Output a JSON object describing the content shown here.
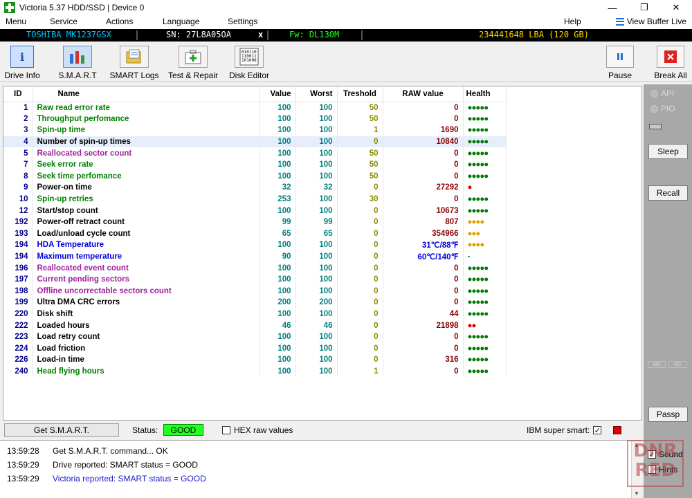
{
  "window": {
    "title": "Victoria 5.37 HDD/SSD | Device 0"
  },
  "menu": {
    "items": [
      "Menu",
      "Service",
      "Actions",
      "Language",
      "Settings",
      "Help"
    ],
    "view_buffer_live": "View Buffer Live"
  },
  "device": {
    "model": "TOSHIBA MK1237GSX",
    "serial": "SN: 27L8A05OA",
    "close": "x",
    "firmware": "Fw: DL130M",
    "capacity": "234441648 LBA (120 GB)"
  },
  "toolbar": {
    "drive_info": "Drive Info",
    "smart": "S.M.A.R.T",
    "smart_logs": "SMART Logs",
    "test_repair": "Test & Repair",
    "disk_editor": "Disk Editor",
    "pause": "Pause",
    "break_all": "Break All"
  },
  "table": {
    "headers": [
      "ID",
      "Name",
      "Value",
      "Worst",
      "Treshold",
      "RAW value",
      "Health"
    ],
    "rows": [
      {
        "id": "1",
        "name": "Raw read error rate",
        "value": "100",
        "worst": "100",
        "thresh": "50",
        "raw": "0",
        "health": "●●●●●",
        "color": "green",
        "hcolor": "green"
      },
      {
        "id": "2",
        "name": "Throughput perfomance",
        "value": "100",
        "worst": "100",
        "thresh": "50",
        "raw": "0",
        "health": "●●●●●",
        "color": "green",
        "hcolor": "green"
      },
      {
        "id": "3",
        "name": "Spin-up time",
        "value": "100",
        "worst": "100",
        "thresh": "1",
        "raw": "1690",
        "health": "●●●●●",
        "color": "green",
        "hcolor": "green"
      },
      {
        "id": "4",
        "name": "Number of spin-up times",
        "value": "100",
        "worst": "100",
        "thresh": "0",
        "raw": "10840",
        "health": "●●●●●",
        "color": "black",
        "hcolor": "green"
      },
      {
        "id": "5",
        "name": "Reallocated sector count",
        "value": "100",
        "worst": "100",
        "thresh": "50",
        "raw": "0",
        "health": "●●●●●",
        "color": "purple",
        "hcolor": "green"
      },
      {
        "id": "7",
        "name": "Seek error rate",
        "value": "100",
        "worst": "100",
        "thresh": "50",
        "raw": "0",
        "health": "●●●●●",
        "color": "green",
        "hcolor": "green"
      },
      {
        "id": "8",
        "name": "Seek time perfomance",
        "value": "100",
        "worst": "100",
        "thresh": "50",
        "raw": "0",
        "health": "●●●●●",
        "color": "green",
        "hcolor": "green"
      },
      {
        "id": "9",
        "name": "Power-on time",
        "value": "32",
        "worst": "32",
        "thresh": "0",
        "raw": "27292",
        "health": "●",
        "color": "black",
        "hcolor": "red"
      },
      {
        "id": "10",
        "name": "Spin-up retries",
        "value": "253",
        "worst": "100",
        "thresh": "30",
        "raw": "0",
        "health": "●●●●●",
        "color": "green",
        "hcolor": "green"
      },
      {
        "id": "12",
        "name": "Start/stop count",
        "value": "100",
        "worst": "100",
        "thresh": "0",
        "raw": "10673",
        "health": "●●●●●",
        "color": "black",
        "hcolor": "green"
      },
      {
        "id": "192",
        "name": "Power-off retract count",
        "value": "99",
        "worst": "99",
        "thresh": "0",
        "raw": "807",
        "health": "●●●●",
        "color": "black",
        "hcolor": "yellow"
      },
      {
        "id": "193",
        "name": "Load/unload cycle count",
        "value": "65",
        "worst": "65",
        "thresh": "0",
        "raw": "354966",
        "health": "●●●",
        "color": "black",
        "hcolor": "yellow"
      },
      {
        "id": "194",
        "name": "HDA Temperature",
        "value": "100",
        "worst": "100",
        "thresh": "0",
        "raw": "31℃/88℉",
        "health": "●●●●",
        "color": "blue",
        "hcolor": "yellow"
      },
      {
        "id": "194",
        "name": "Maximum temperature",
        "value": "90",
        "worst": "100",
        "thresh": "0",
        "raw": "60℃/140℉",
        "health": "-",
        "color": "blue",
        "hcolor": "green"
      },
      {
        "id": "196",
        "name": "Reallocated event count",
        "value": "100",
        "worst": "100",
        "thresh": "0",
        "raw": "0",
        "health": "●●●●●",
        "color": "purple",
        "hcolor": "green"
      },
      {
        "id": "197",
        "name": "Current pending sectors",
        "value": "100",
        "worst": "100",
        "thresh": "0",
        "raw": "0",
        "health": "●●●●●",
        "color": "purple",
        "hcolor": "green"
      },
      {
        "id": "198",
        "name": "Offline uncorrectable sectors count",
        "value": "100",
        "worst": "100",
        "thresh": "0",
        "raw": "0",
        "health": "●●●●●",
        "color": "purple",
        "hcolor": "green"
      },
      {
        "id": "199",
        "name": "Ultra DMA CRC errors",
        "value": "200",
        "worst": "200",
        "thresh": "0",
        "raw": "0",
        "health": "●●●●●",
        "color": "black",
        "hcolor": "green"
      },
      {
        "id": "220",
        "name": "Disk shift",
        "value": "100",
        "worst": "100",
        "thresh": "0",
        "raw": "44",
        "health": "●●●●●",
        "color": "black",
        "hcolor": "green"
      },
      {
        "id": "222",
        "name": "Loaded hours",
        "value": "46",
        "worst": "46",
        "thresh": "0",
        "raw": "21898",
        "health": "●●",
        "color": "black",
        "hcolor": "red"
      },
      {
        "id": "223",
        "name": "Load retry count",
        "value": "100",
        "worst": "100",
        "thresh": "0",
        "raw": "0",
        "health": "●●●●●",
        "color": "black",
        "hcolor": "green"
      },
      {
        "id": "224",
        "name": "Load friction",
        "value": "100",
        "worst": "100",
        "thresh": "0",
        "raw": "0",
        "health": "●●●●●",
        "color": "black",
        "hcolor": "green"
      },
      {
        "id": "226",
        "name": "Load-in time",
        "value": "100",
        "worst": "100",
        "thresh": "0",
        "raw": "316",
        "health": "●●●●●",
        "color": "black",
        "hcolor": "green"
      },
      {
        "id": "240",
        "name": "Head flying hours",
        "value": "100",
        "worst": "100",
        "thresh": "1",
        "raw": "0",
        "health": "●●●●●",
        "color": "green",
        "hcolor": "green"
      }
    ]
  },
  "right_panel": {
    "api": "API",
    "pio": "PIO",
    "sleep": "Sleep",
    "recall": "Recall",
    "wr": "WR",
    "rd": "RD",
    "passp": "Passp"
  },
  "statusbar": {
    "get_smart": "Get S.M.A.R.T.",
    "status_label": "Status:",
    "status_value": "GOOD",
    "hex_raw": "HEX raw values",
    "ibm_super_smart": "IBM super smart:",
    "ibm_checked": "✓"
  },
  "log": [
    {
      "time": "13:59:28",
      "text": "Get S.M.A.R.T. command... OK",
      "color": "#000000"
    },
    {
      "time": "13:59:29",
      "text": "Drive reported: SMART status = GOOD",
      "color": "#000000"
    },
    {
      "time": "13:59:29",
      "text": "Victoria reported: SMART status = GOOD",
      "color": "#1a1ad0"
    }
  ],
  "options": {
    "sound": "Sound",
    "hints": "Hints",
    "checked": "✓"
  },
  "watermark": {
    "line1": "DNR",
    "line2": "RED"
  },
  "colors": {
    "good": "#22ff22",
    "infobar_bg": "#000000",
    "serial": "#ffffff",
    "model": "#00c8ff",
    "firmware": "#22ff22",
    "capacity": "#ffd700"
  }
}
